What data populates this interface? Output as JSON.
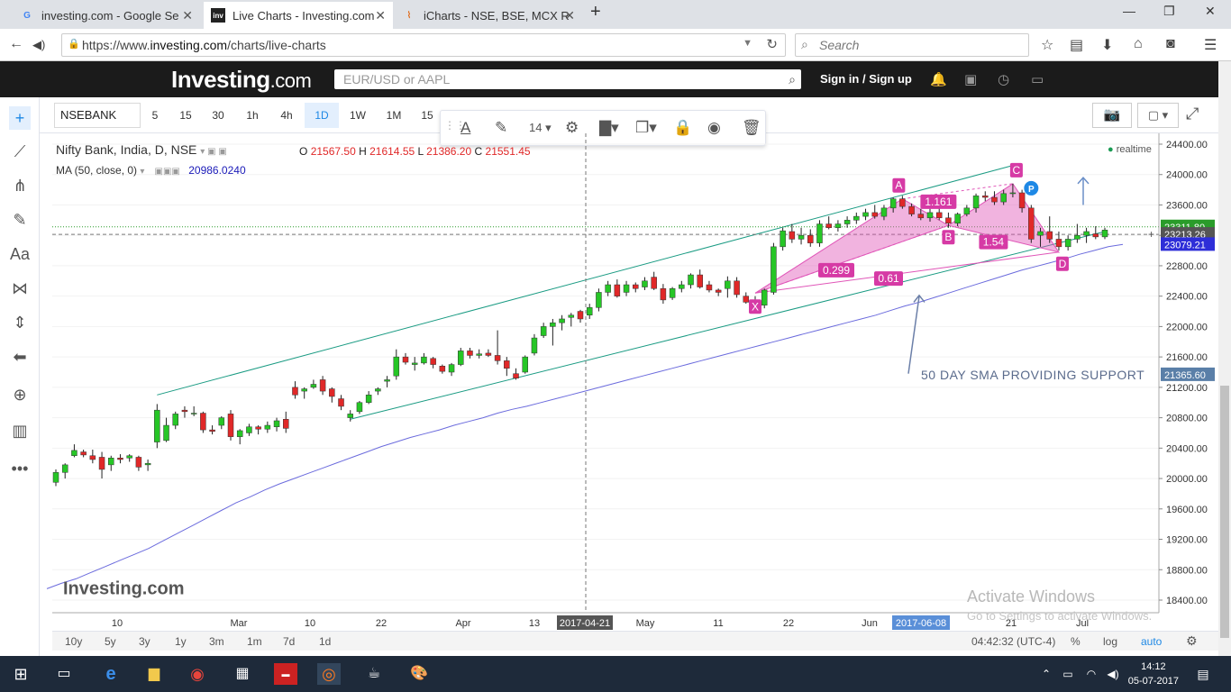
{
  "browser": {
    "tabs": [
      {
        "title": "investing.com - Google Se",
        "icon": "google-icon",
        "active": false
      },
      {
        "title": "Live Charts - Investing.com",
        "icon": "investing-icon",
        "active": true
      },
      {
        "title": "iCharts - NSE, BSE, MCX R",
        "icon": "icharts-icon",
        "active": false
      }
    ],
    "url_prefix": "https://www.",
    "url_domain": "investing.com",
    "url_path": "/charts/live-charts",
    "search_placeholder": "Search"
  },
  "site": {
    "logo_main": "Investing",
    "logo_suffix": ".com",
    "search_placeholder": "EUR/USD or AAPL",
    "signin": "Sign in",
    "signup": "Sign up",
    "separator": "/"
  },
  "toolbar": {
    "symbol": "NSEBANK",
    "intervals": [
      "5",
      "15",
      "30",
      "1h",
      "4h",
      "1D",
      "1W",
      "1M",
      "15"
    ],
    "selected_interval": "1D",
    "font_size": "14"
  },
  "legend": {
    "title": "Nifty Bank, India, D, NSE",
    "o_label": "O",
    "o": "21567.50",
    "h_label": "H",
    "h": "21614.55",
    "l_label": "L",
    "l": "21386.20",
    "c_label": "C",
    "c": "21551.45",
    "ma_label": "MA (50, close, 0)",
    "ma_value": "20986.0240",
    "realtime": "realtime"
  },
  "chart_data": {
    "type": "candlestick",
    "title": "Nifty Bank, India, D, NSE",
    "ylim": [
      18200,
      24600
    ],
    "y_ticks": [
      18400,
      18800,
      19200,
      19600,
      20000,
      20400,
      20800,
      21200,
      21600,
      22000,
      22400,
      22800,
      23200,
      23600,
      24000,
      24400
    ],
    "x_tick_labels": [
      "10",
      "Mar",
      "10",
      "22",
      "Apr",
      "13",
      "May",
      "11",
      "22",
      "Jun",
      "21",
      "Jul"
    ],
    "crosshair_x_label": "2017-04-21",
    "highlight_x_label": "2017-06-08",
    "price_labels": {
      "last": "23213.26",
      "ma": "23079.21",
      "crosshair": "21365.60",
      "prev": "23311.80"
    },
    "candles": [
      [
        19950,
        20120,
        19900,
        20080
      ],
      [
        20080,
        20200,
        20000,
        20180
      ],
      [
        20300,
        20450,
        20280,
        20370
      ],
      [
        20350,
        20380,
        20280,
        20310
      ],
      [
        20300,
        20380,
        20200,
        20250
      ],
      [
        20280,
        20350,
        20000,
        20120
      ],
      [
        20180,
        20300,
        20100,
        20270
      ],
      [
        20270,
        20320,
        20200,
        20250
      ],
      [
        20270,
        20320,
        20220,
        20300
      ],
      [
        20280,
        20300,
        20100,
        20150
      ],
      [
        20180,
        20250,
        20100,
        20200
      ],
      [
        20480,
        20980,
        20400,
        20900
      ],
      [
        20500,
        20800,
        20480,
        20700
      ],
      [
        20700,
        20880,
        20650,
        20850
      ],
      [
        20900,
        20950,
        20800,
        20880
      ],
      [
        20850,
        20950,
        20820,
        20860
      ],
      [
        20860,
        20880,
        20600,
        20640
      ],
      [
        20640,
        20700,
        20580,
        20620
      ],
      [
        20700,
        20820,
        20650,
        20800
      ],
      [
        20850,
        20900,
        20500,
        20550
      ],
      [
        20550,
        20650,
        20450,
        20630
      ],
      [
        20600,
        20720,
        20560,
        20680
      ],
      [
        20680,
        20700,
        20580,
        20650
      ],
      [
        20650,
        20750,
        20600,
        20700
      ],
      [
        20680,
        20800,
        20620,
        20760
      ],
      [
        20780,
        20880,
        20600,
        20660
      ],
      [
        21200,
        21280,
        21050,
        21100
      ],
      [
        21150,
        21200,
        21050,
        21180
      ],
      [
        21200,
        21300,
        21180,
        21240
      ],
      [
        21300,
        21350,
        21100,
        21150
      ],
      [
        21180,
        21200,
        21000,
        21080
      ],
      [
        21050,
        21100,
        20900,
        20950
      ],
      [
        20800,
        20900,
        20750,
        20850
      ],
      [
        20880,
        21020,
        20850,
        21000
      ],
      [
        21000,
        21150,
        20980,
        21100
      ],
      [
        21150,
        21200,
        21100,
        21180
      ],
      [
        21280,
        21350,
        21200,
        21300
      ],
      [
        21350,
        21700,
        21300,
        21600
      ],
      [
        21600,
        21650,
        21500,
        21530
      ],
      [
        21500,
        21600,
        21420,
        21520
      ],
      [
        21520,
        21650,
        21500,
        21600
      ],
      [
        21580,
        21600,
        21450,
        21500
      ],
      [
        21480,
        21500,
        21380,
        21410
      ],
      [
        21400,
        21520,
        21350,
        21500
      ],
      [
        21500,
        21720,
        21480,
        21680
      ],
      [
        21680,
        21720,
        21580,
        21620
      ],
      [
        21620,
        21700,
        21580,
        21640
      ],
      [
        21650,
        21700,
        21600,
        21620
      ],
      [
        21620,
        21950,
        21500,
        21550
      ],
      [
        21550,
        21600,
        21350,
        21450
      ],
      [
        21380,
        21450,
        21300,
        21320
      ],
      [
        21400,
        21620,
        21380,
        21600
      ],
      [
        21650,
        21900,
        21620,
        21850
      ],
      [
        21880,
        22050,
        21850,
        22000
      ],
      [
        22000,
        22100,
        21750,
        22050
      ],
      [
        22050,
        22150,
        21950,
        22100
      ],
      [
        22120,
        22180,
        22000,
        22150
      ],
      [
        22200,
        22220,
        22050,
        22100
      ],
      [
        22150,
        22300,
        22100,
        22250
      ],
      [
        22250,
        22500,
        22200,
        22450
      ],
      [
        22450,
        22600,
        22400,
        22550
      ],
      [
        22550,
        22620,
        22380,
        22400
      ],
      [
        22450,
        22600,
        22400,
        22550
      ],
      [
        22550,
        22580,
        22450,
        22500
      ],
      [
        22520,
        22650,
        22480,
        22600
      ],
      [
        22650,
        22720,
        22480,
        22500
      ],
      [
        22500,
        22560,
        22300,
        22350
      ],
      [
        22380,
        22520,
        22350,
        22500
      ],
      [
        22500,
        22600,
        22450,
        22550
      ],
      [
        22550,
        22700,
        22500,
        22680
      ],
      [
        22680,
        22750,
        22500,
        22520
      ],
      [
        22550,
        22600,
        22450,
        22480
      ],
      [
        22480,
        22500,
        22400,
        22450
      ],
      [
        22500,
        22660,
        22380,
        22600
      ],
      [
        22600,
        22650,
        22380,
        22420
      ],
      [
        22400,
        22450,
        22300,
        22320
      ],
      [
        22320,
        22400,
        22200,
        22250
      ],
      [
        22280,
        22500,
        22240,
        22480
      ],
      [
        22450,
        23100,
        22420,
        23050
      ],
      [
        23050,
        23300,
        23000,
        23260
      ],
      [
        23250,
        23350,
        23100,
        23150
      ],
      [
        23150,
        23300,
        23080,
        23200
      ],
      [
        23200,
        23280,
        23050,
        23100
      ],
      [
        23100,
        23400,
        23050,
        23350
      ],
      [
        23350,
        23450,
        23280,
        23300
      ],
      [
        23300,
        23400,
        23250,
        23350
      ],
      [
        23350,
        23450,
        23300,
        23400
      ],
      [
        23400,
        23500,
        23350,
        23450
      ],
      [
        23450,
        23550,
        23400,
        23500
      ],
      [
        23500,
        23600,
        23420,
        23450
      ],
      [
        23450,
        23600,
        23400,
        23560
      ],
      [
        23560,
        23700,
        23500,
        23680
      ],
      [
        23680,
        23720,
        23550,
        23580
      ],
      [
        23580,
        23620,
        23450,
        23480
      ],
      [
        23480,
        23550,
        23400,
        23430
      ],
      [
        23430,
        23550,
        23380,
        23500
      ],
      [
        23500,
        23580,
        23400,
        23430
      ],
      [
        23430,
        23500,
        23300,
        23360
      ],
      [
        23360,
        23500,
        23320,
        23480
      ],
      [
        23480,
        23600,
        23450,
        23560
      ],
      [
        23560,
        23750,
        23500,
        23720
      ],
      [
        23720,
        23780,
        23650,
        23700
      ],
      [
        23700,
        23780,
        23600,
        23640
      ],
      [
        23640,
        23800,
        23600,
        23750
      ],
      [
        23750,
        23880,
        23700,
        23760
      ],
      [
        23760,
        23800,
        23500,
        23560
      ],
      [
        23560,
        23600,
        23100,
        23150
      ],
      [
        23200,
        23300,
        23050,
        23250
      ],
      [
        23250,
        23450,
        23100,
        23150
      ],
      [
        23150,
        23250,
        23000,
        23050
      ],
      [
        23050,
        23200,
        23000,
        23150
      ],
      [
        23150,
        23350,
        23100,
        23200
      ],
      [
        23200,
        23300,
        23100,
        23250
      ],
      [
        23220,
        23320,
        23150,
        23180
      ],
      [
        23180,
        23300,
        23150,
        23270
      ]
    ],
    "ma_series": [
      18550,
      18620,
      18680,
      18760,
      18840,
      18920,
      19000,
      19080,
      19180,
      19280,
      19380,
      19480,
      19580,
      19680,
      19760,
      19850,
      19930,
      20000,
      20070,
      20140,
      20210,
      20280,
      20350,
      20420,
      20480,
      20540,
      20590,
      20640,
      20700,
      20750,
      20800,
      20860,
      20910,
      20950,
      21000,
      21050,
      21100,
      21150,
      21200,
      21250,
      21300,
      21350,
      21400,
      21450,
      21500,
      21550,
      21600,
      21650,
      21700,
      21750,
      21800,
      21850,
      21900,
      21950,
      22000,
      22050,
      22100,
      22150,
      22210,
      22270,
      22320,
      22380,
      22440,
      22500,
      22560,
      22620,
      22680,
      22740,
      22790,
      22840,
      22890,
      22950,
      23000,
      23050,
      23080
    ],
    "annotations": {
      "pattern_points": [
        "X",
        "A",
        "B",
        "C",
        "D"
      ],
      "ratios": [
        "1.161",
        "0.299",
        "1.54",
        "0.61"
      ],
      "p_label": "P",
      "note": "50 DAY SMA PROVIDING SUPPORT",
      "watermark": "Investing.com"
    }
  },
  "bottom": {
    "ranges": [
      "10y",
      "5y",
      "3y",
      "1y",
      "3m",
      "1m",
      "7d",
      "1d"
    ],
    "time": "04:42:32 (UTC-4)",
    "percent": "%",
    "log": "log",
    "auto": "auto"
  },
  "windows": {
    "activate_title": "Activate Windows",
    "activate_sub": "Go to Settings to activate Windows.",
    "time": "14:12",
    "date": "05-07-2017"
  },
  "colors": {
    "up": "#26c626",
    "down": "#e02828",
    "channel": "#1a9b83",
    "ma": "#6b6bdd",
    "pattern": "#e056b8",
    "accent": "#1e88e5"
  }
}
